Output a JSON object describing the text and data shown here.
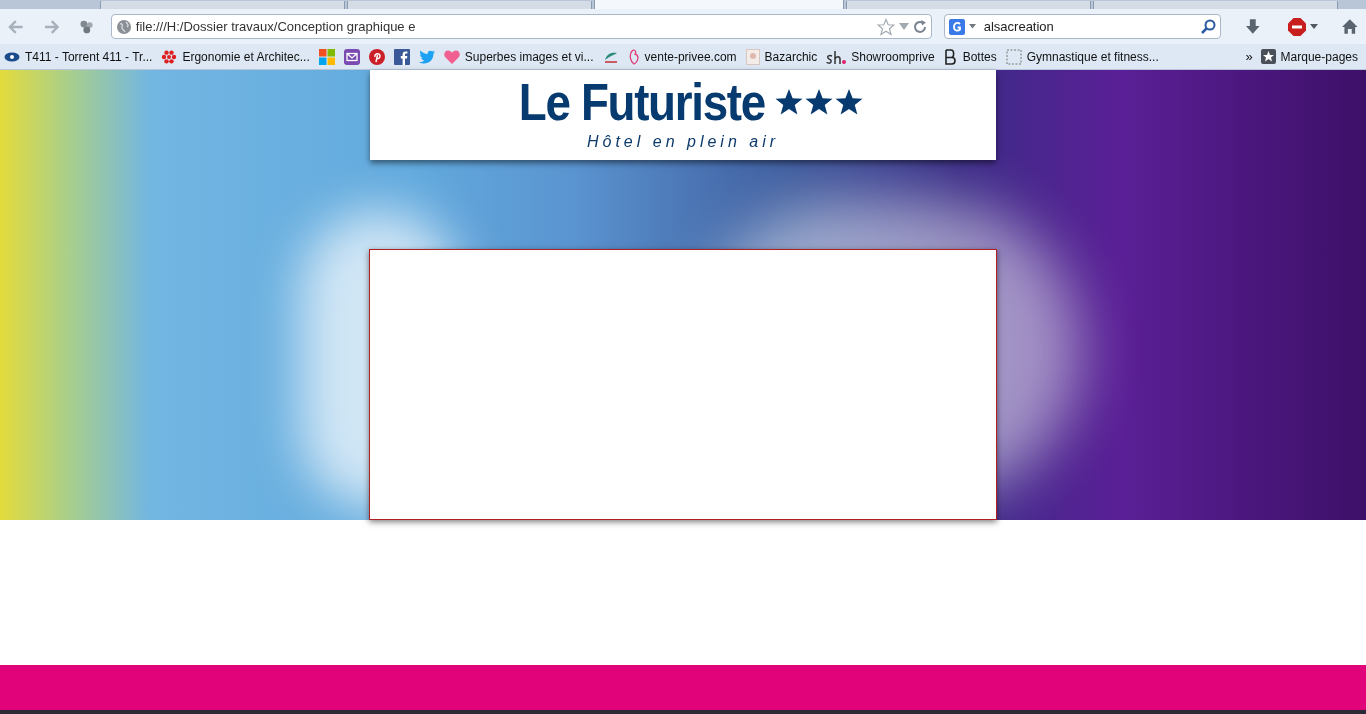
{
  "browser": {
    "tabs": [
      {
        "selected": false
      },
      {
        "selected": false
      },
      {
        "selected": true
      },
      {
        "selected": false
      },
      {
        "selected": false
      }
    ],
    "address": "file:///H:/Dossier travaux/Conception graphique e",
    "search": {
      "value": "alsacreation"
    },
    "bookmarks": [
      {
        "kind": "tracker",
        "label": "T411 - Torrent 411 - Tr..."
      },
      {
        "kind": "dots",
        "label": "Ergonomie et Architec..."
      },
      {
        "kind": "windows"
      },
      {
        "kind": "mail"
      },
      {
        "kind": "pinterest"
      },
      {
        "kind": "facebook"
      },
      {
        "kind": "twitter"
      },
      {
        "kind": "heart",
        "label": "Superbes images et vi..."
      },
      {
        "kind": "bank"
      },
      {
        "kind": "butterfly",
        "label": "vente-privee.com"
      },
      {
        "kind": "photo",
        "label": "Bazarchic"
      },
      {
        "kind": "sh",
        "label": "Showroomprive"
      },
      {
        "kind": "letter",
        "label": "Bottes"
      },
      {
        "kind": "blank",
        "label": "Gymnastique et fitness..."
      }
    ],
    "bookmarks_more": "»",
    "bookmarks_menu": "Marque-pages"
  },
  "page": {
    "header": {
      "title": "Le Futuriste",
      "stars": 3,
      "subtitle": "Hôtel en plein air"
    }
  }
}
